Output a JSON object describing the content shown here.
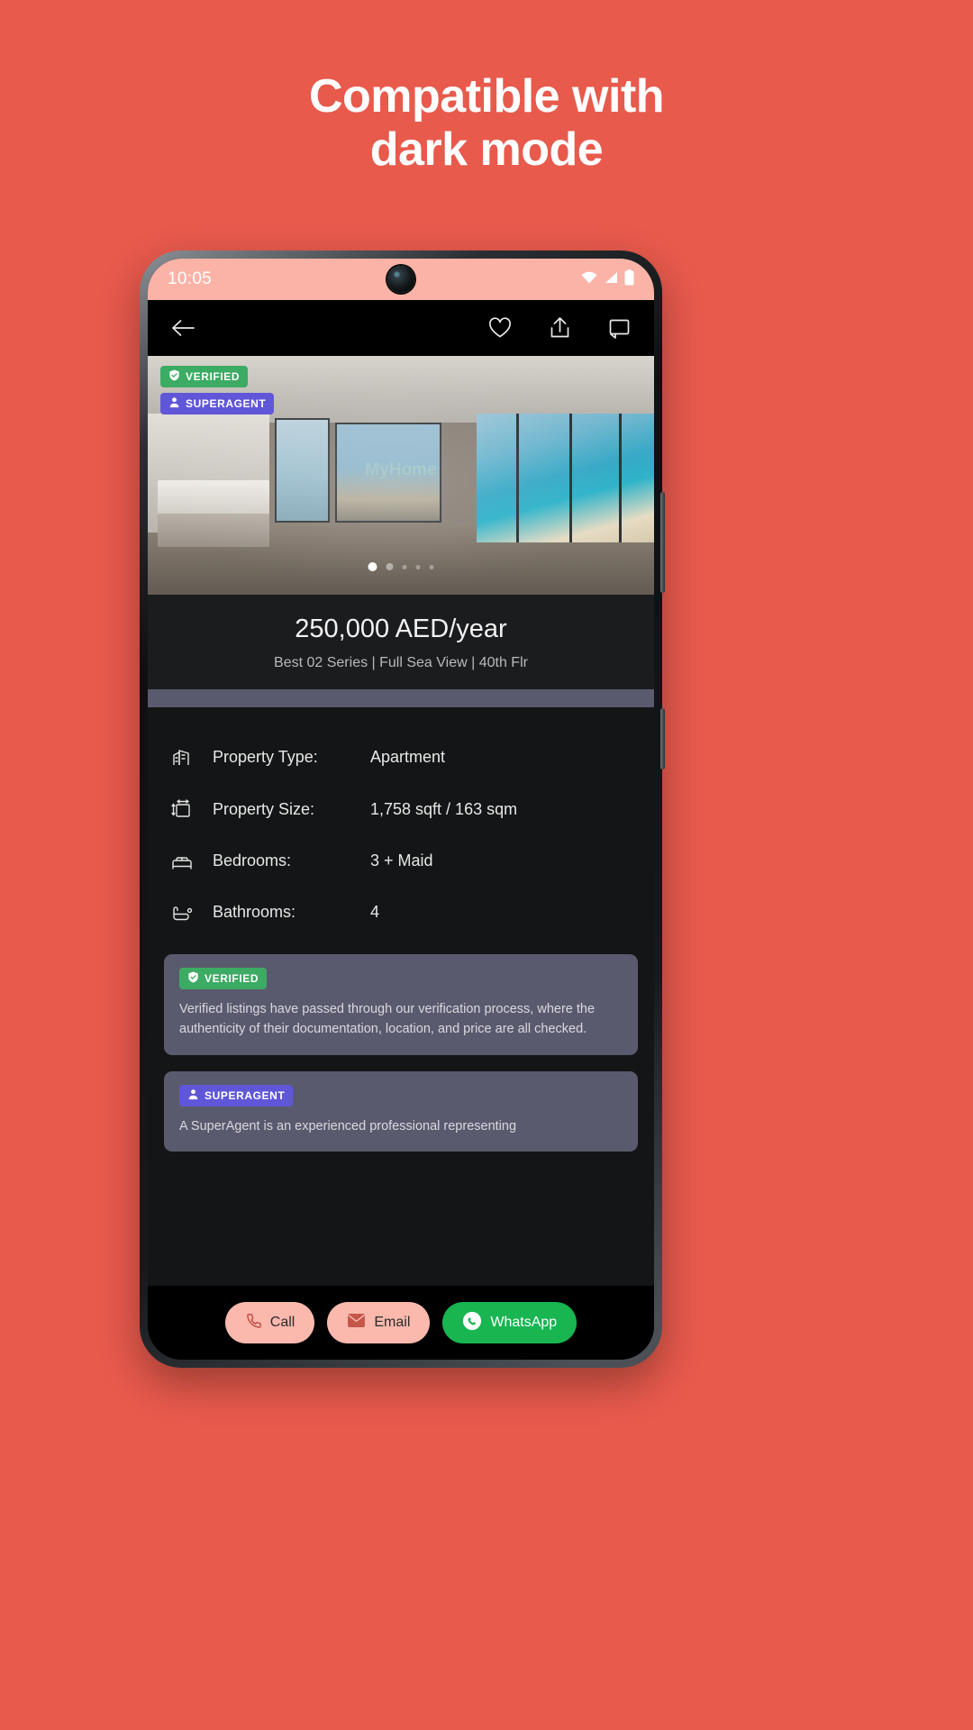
{
  "promo": {
    "headline_line1": "Compatible with",
    "headline_line2": "dark mode",
    "background_color": "#e85a4c",
    "text_color": "#ffffff"
  },
  "phone": {
    "status_bar": {
      "time": "10:05",
      "background_color": "#fcb3a7",
      "icons": [
        "wifi-icon",
        "cellular-signal-icon",
        "battery-icon"
      ]
    },
    "app_nav": {
      "back_icon": "back-arrow-icon",
      "actions": [
        "heart-icon",
        "share-icon",
        "flag-icon"
      ]
    }
  },
  "listing": {
    "gallery": {
      "watermark": "MyHome",
      "badges": [
        {
          "label": "VERIFIED",
          "icon": "shield-check-icon",
          "color": "#3cab63"
        },
        {
          "label": "SUPERAGENT",
          "icon": "agent-badge-icon",
          "color": "#6056d8"
        }
      ],
      "dot_count": 5,
      "active_dot_index": 0
    },
    "price": "250,000 AED/year",
    "subtitle": "Best 02 Series | Full Sea View | 40th Flr",
    "details": [
      {
        "icon": "building-icon",
        "label": "Property Type:",
        "value": "Apartment"
      },
      {
        "icon": "area-size-icon",
        "label": "Property Size:",
        "value": "1,758 sqft / 163 sqm"
      },
      {
        "icon": "bed-icon",
        "label": "Bedrooms:",
        "value": "3 + Maid"
      },
      {
        "icon": "bathtub-icon",
        "label": "Bathrooms:",
        "value": "4"
      }
    ],
    "info_cards": [
      {
        "badge_label": "VERIFIED",
        "badge_icon": "shield-check-icon",
        "badge_color": "#3cab63",
        "body": "Verified listings have passed through our verification process, where the authenticity of their documentation, location, and price are all checked."
      },
      {
        "badge_label": "SUPERAGENT",
        "badge_icon": "agent-badge-icon",
        "badge_color": "#6056d8",
        "body": "A SuperAgent is an experienced professional representing"
      }
    ],
    "bottom_actions": [
      {
        "label": "Call",
        "icon": "phone-icon",
        "background": "#fbb9ae",
        "text_color": "#2a2a2a"
      },
      {
        "label": "Email",
        "icon": "envelope-icon",
        "background": "#fbb9ae",
        "text_color": "#2a2a2a"
      },
      {
        "label": "WhatsApp",
        "icon": "whatsapp-icon",
        "background": "#18b551",
        "text_color": "#ffffff"
      }
    ]
  }
}
